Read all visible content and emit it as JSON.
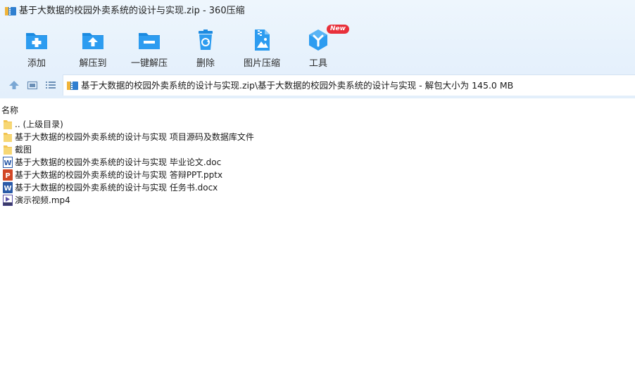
{
  "window": {
    "title": "基于大数据的校园外卖系统的设计与实现.zip - 360压缩"
  },
  "toolbar": {
    "items": [
      {
        "label": "添加",
        "icon": "add-folder-icon"
      },
      {
        "label": "解压到",
        "icon": "extract-to-icon"
      },
      {
        "label": "一键解压",
        "icon": "one-click-extract-icon"
      },
      {
        "label": "删除",
        "icon": "trash-icon"
      },
      {
        "label": "图片压缩",
        "icon": "image-compress-icon"
      },
      {
        "label": "工具",
        "icon": "tools-icon",
        "badge": "New"
      }
    ]
  },
  "address": {
    "path": "基于大数据的校园外卖系统的设计与实现.zip\\基于大数据的校园外卖系统的设计与实现 - 解包大小为 145.0 MB"
  },
  "list": {
    "column_name": "名称",
    "rows": [
      {
        "name": ".. (上级目录)",
        "type": "folder"
      },
      {
        "name": "基于大数据的校园外卖系统的设计与实现 项目源码及数据库文件",
        "type": "folder"
      },
      {
        "name": "截图",
        "type": "folder"
      },
      {
        "name": "基于大数据的校园外卖系统的设计与实现 毕业论文.doc",
        "type": "word"
      },
      {
        "name": "基于大数据的校园外卖系统的设计与实现 答辩PPT.pptx",
        "type": "ppt"
      },
      {
        "name": "基于大数据的校园外卖系统的设计与实现 任务书.docx",
        "type": "word"
      },
      {
        "name": "演示视频.mp4",
        "type": "video"
      }
    ]
  },
  "colors": {
    "accent": "#1a87d8",
    "header_bg": "#e6f1fc",
    "badge": "#e8303a"
  }
}
